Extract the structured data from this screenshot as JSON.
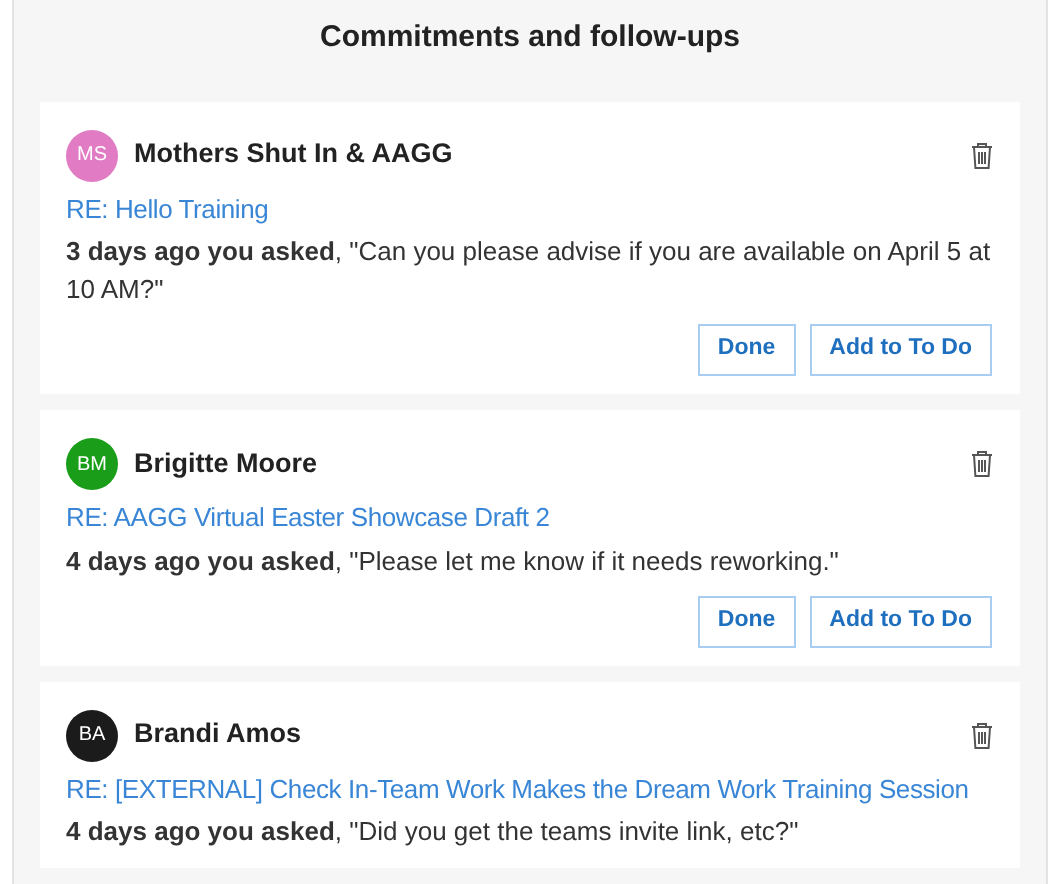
{
  "title": "Commitments and follow-ups",
  "cards": [
    {
      "initials": "MS",
      "color": "#e07bc4",
      "name": "Mothers Shut In & AAGG",
      "subject": "RE: Hello Training",
      "text": "**3 days ago you asked**, \"Can you please advise if you are available on April 5 at 10 AM?\"",
      "buttons": [
        "Done",
        "Add to To Do"
      ]
    },
    {
      "initials": "BM",
      "color": "#1a9e1a",
      "name": "Brigitte Moore",
      "subject": "RE: AAGG Virtual Easter Showcase Draft 2",
      "text": "**4 days ago you asked**, \"Please let me know if it needs reworking.\"",
      "buttons": [
        "Done",
        "Add to To Do"
      ]
    },
    {
      "initials": "BA",
      "color": "#1b1b1b",
      "name": "Brandi Amos",
      "subject": "RE: [EXTERNAL] Check In-Team Work Makes the Dream Work Training Session",
      "text": "**4 days ago you asked**, \"Did you get the teams invite link, etc?\""
    }
  ]
}
